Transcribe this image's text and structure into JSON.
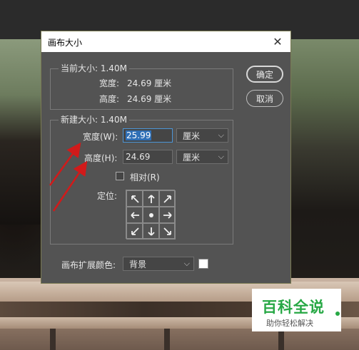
{
  "dialog": {
    "title": "画布大小",
    "close_glyph": "✕",
    "current": {
      "legend": "当前大小: 1.40M",
      "width_label": "宽度:",
      "width_value": "24.69 厘米",
      "height_label": "高度:",
      "height_value": "24.69 厘米"
    },
    "new": {
      "legend": "新建大小: 1.40M",
      "width_label": "宽度(W):",
      "width_value": "25.99",
      "width_unit": "厘米",
      "height_label": "高度(H):",
      "height_value": "24.69",
      "height_unit": "厘米",
      "relative_label": "相对(R)",
      "relative_checked": false,
      "anchor_label": "定位:",
      "anchor_icons": [
        "arrow-nw-icon",
        "arrow-n-icon",
        "arrow-ne-icon",
        "arrow-w-icon",
        "anchor-center-icon",
        "arrow-e-icon",
        "arrow-sw-icon",
        "arrow-s-icon",
        "arrow-se-icon"
      ]
    },
    "extension_color_label": "画布扩展颜色:",
    "extension_color_value": "背景",
    "extension_swatch_color": "#ffffff",
    "ok_label": "确定",
    "cancel_label": "取消"
  },
  "annotation": {
    "arrow_color": "#d11a1a"
  },
  "watermark": {
    "title": "百科全说",
    "subtitle": "助你轻松解决",
    "color": "#27a845"
  }
}
